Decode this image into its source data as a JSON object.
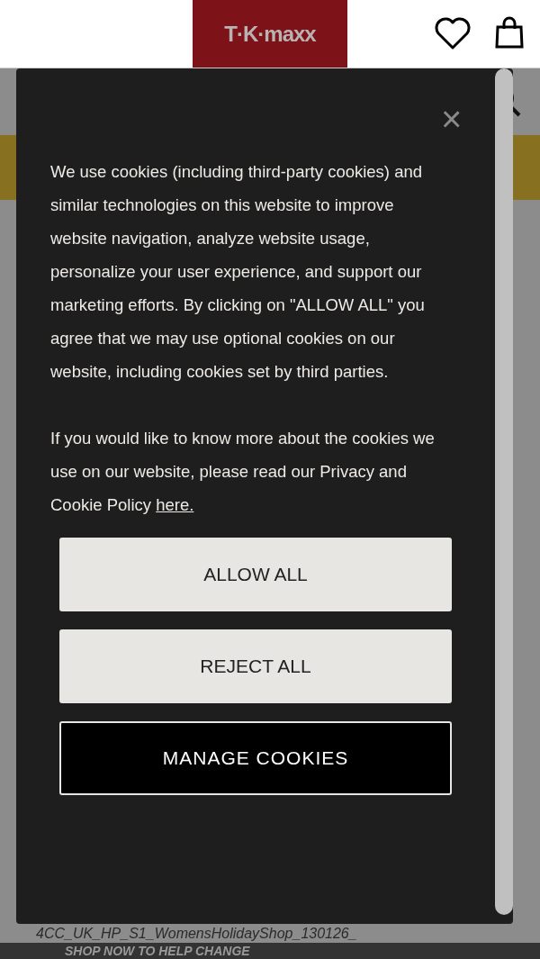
{
  "header": {
    "logo": "T·K·maxx"
  },
  "cookie_dialog": {
    "close": "×",
    "paragraphs": [
      "We use cookies (including third-party cookies) and similar technologies on this website to improve website navigation, analyze website usage, personalize your user experience, and support our marketing efforts. By clicking on \"ALLOW ALL\" you agree that we may use optional cookies on our website, including cookies set by third parties.",
      "If you would like to know more about the cookies we use on our website, please read our Privacy and Cookie Policy"
    ],
    "link": "here.",
    "buttons": [
      {
        "label": "ALLOW ALL",
        "kind": "light"
      },
      {
        "label": "REJECT ALL",
        "kind": "light"
      },
      {
        "label": "MANAGE COOKIES",
        "kind": "dark"
      }
    ]
  },
  "footer": {
    "image_alt": "4CC_UK_HP_S1_WomensHolidayShop_130126_",
    "banner": "SHOP NOW TO HELP CHANGE"
  }
}
